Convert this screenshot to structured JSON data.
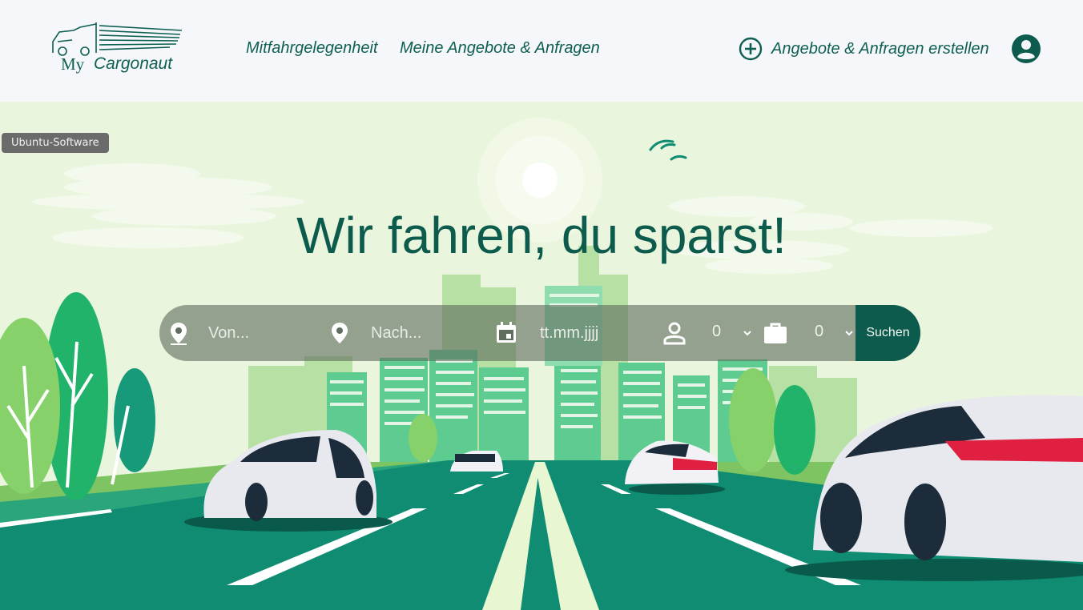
{
  "logo": {
    "prefix": "My",
    "name": "Cargonaut"
  },
  "nav": {
    "rideshare": "Mitfahrgelegenheit",
    "my_offers": "Meine Angebote & Anfragen",
    "create": "Angebote & Anfragen erstellen"
  },
  "badge": "Ubuntu-Software",
  "hero": {
    "headline": "Wir fahren, du sparst!"
  },
  "search": {
    "from_placeholder": "Von...",
    "to_placeholder": "Nach...",
    "date_placeholder": "tt.mm.jjjj",
    "passengers": "0",
    "luggage": "0",
    "button": "Suchen"
  },
  "icons": {
    "from": "location-pin-icon",
    "to": "location-pin-icon",
    "date": "calendar-icon",
    "passengers": "person-icon",
    "luggage": "briefcase-icon",
    "create": "plus-circle-icon",
    "account": "account-circle-icon"
  },
  "colors": {
    "brand": "#0d5b4d",
    "header_bg": "#f5f7fb",
    "sky": "#e9f5dc",
    "road": "#0f8c72"
  }
}
